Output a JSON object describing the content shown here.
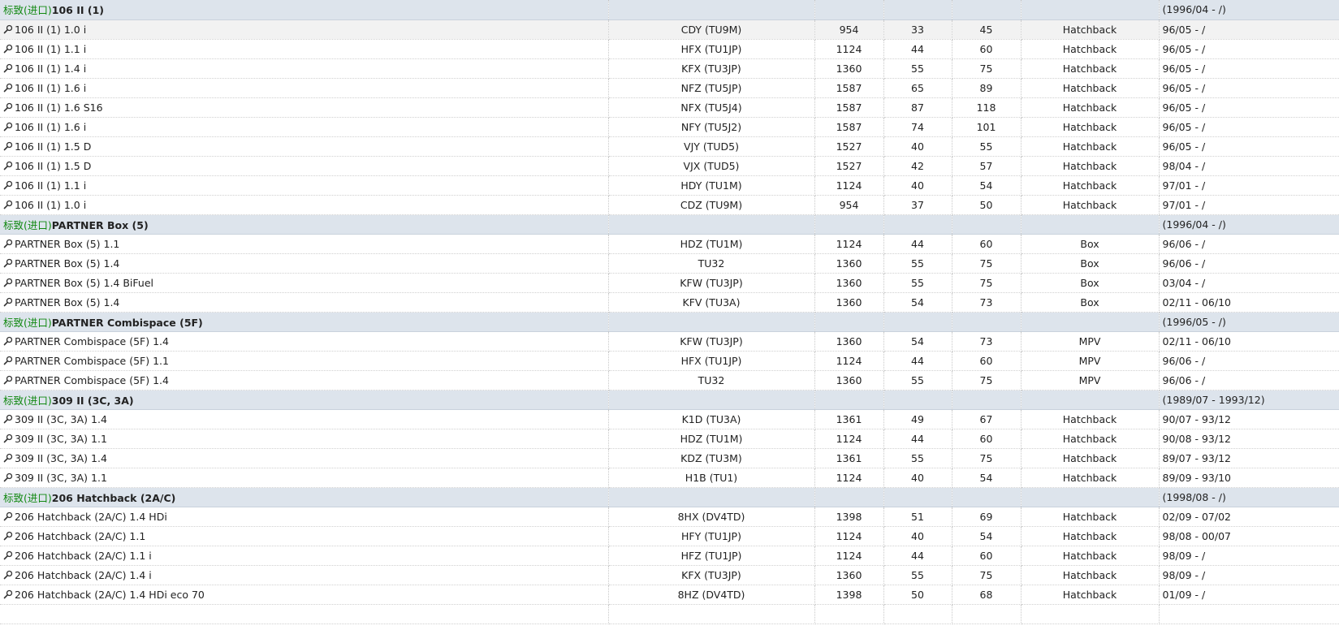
{
  "groups": [
    {
      "brand": "标致(进口)",
      "name": "106 II (1)",
      "years": "(1996/04 - /)",
      "rows": [
        {
          "model": "106 II (1) 1.0 i",
          "engine": "CDY (TU9M)",
          "ccm": "954",
          "kw": "33",
          "hp": "45",
          "body": "Hatchback",
          "years": "96/05 - /"
        },
        {
          "model": "106 II (1) 1.1 i",
          "engine": "HFX (TU1JP)",
          "ccm": "1124",
          "kw": "44",
          "hp": "60",
          "body": "Hatchback",
          "years": "96/05 - /"
        },
        {
          "model": "106 II (1) 1.4 i",
          "engine": "KFX (TU3JP)",
          "ccm": "1360",
          "kw": "55",
          "hp": "75",
          "body": "Hatchback",
          "years": "96/05 - /"
        },
        {
          "model": "106 II (1) 1.6 i",
          "engine": "NFZ (TU5JP)",
          "ccm": "1587",
          "kw": "65",
          "hp": "89",
          "body": "Hatchback",
          "years": "96/05 - /"
        },
        {
          "model": "106 II (1) 1.6 S16",
          "engine": "NFX (TU5J4)",
          "ccm": "1587",
          "kw": "87",
          "hp": "118",
          "body": "Hatchback",
          "years": "96/05 - /"
        },
        {
          "model": "106 II (1) 1.6 i",
          "engine": "NFY (TU5J2)",
          "ccm": "1587",
          "kw": "74",
          "hp": "101",
          "body": "Hatchback",
          "years": "96/05 - /"
        },
        {
          "model": "106 II (1) 1.5 D",
          "engine": "VJY (TUD5)",
          "ccm": "1527",
          "kw": "40",
          "hp": "55",
          "body": "Hatchback",
          "years": "96/05 - /"
        },
        {
          "model": "106 II (1) 1.5 D",
          "engine": "VJX (TUD5)",
          "ccm": "1527",
          "kw": "42",
          "hp": "57",
          "body": "Hatchback",
          "years": "98/04 - /"
        },
        {
          "model": "106 II (1) 1.1 i",
          "engine": "HDY (TU1M)",
          "ccm": "1124",
          "kw": "40",
          "hp": "54",
          "body": "Hatchback",
          "years": "97/01 - /"
        },
        {
          "model": "106 II (1) 1.0 i",
          "engine": "CDZ (TU9M)",
          "ccm": "954",
          "kw": "37",
          "hp": "50",
          "body": "Hatchback",
          "years": "97/01 - /"
        }
      ]
    },
    {
      "brand": "标致(进口)",
      "name": "PARTNER Box (5)",
      "years": "(1996/04 - /)",
      "rows": [
        {
          "model": "PARTNER Box (5) 1.1",
          "engine": "HDZ (TU1M)",
          "ccm": "1124",
          "kw": "44",
          "hp": "60",
          "body": "Box",
          "years": "96/06 - /"
        },
        {
          "model": "PARTNER Box (5) 1.4",
          "engine": "TU32",
          "ccm": "1360",
          "kw": "55",
          "hp": "75",
          "body": "Box",
          "years": "96/06 - /"
        },
        {
          "model": "PARTNER Box (5) 1.4 BiFuel",
          "engine": "KFW (TU3JP)",
          "ccm": "1360",
          "kw": "55",
          "hp": "75",
          "body": "Box",
          "years": "03/04 - /"
        },
        {
          "model": "PARTNER Box (5) 1.4",
          "engine": "KFV (TU3A)",
          "ccm": "1360",
          "kw": "54",
          "hp": "73",
          "body": "Box",
          "years": "02/11 - 06/10"
        }
      ]
    },
    {
      "brand": "标致(进口)",
      "name": "PARTNER Combispace (5F)",
      "years": "(1996/05 - /)",
      "rows": [
        {
          "model": "PARTNER Combispace (5F) 1.4",
          "engine": "KFW (TU3JP)",
          "ccm": "1360",
          "kw": "54",
          "hp": "73",
          "body": "MPV",
          "years": "02/11 - 06/10"
        },
        {
          "model": "PARTNER Combispace (5F) 1.1",
          "engine": "HFX (TU1JP)",
          "ccm": "1124",
          "kw": "44",
          "hp": "60",
          "body": "MPV",
          "years": "96/06 - /"
        },
        {
          "model": "PARTNER Combispace (5F) 1.4",
          "engine": "TU32",
          "ccm": "1360",
          "kw": "55",
          "hp": "75",
          "body": "MPV",
          "years": "96/06 - /"
        }
      ]
    },
    {
      "brand": "标致(进口)",
      "name": "309 II (3C, 3A)",
      "years": "(1989/07 - 1993/12)",
      "rows": [
        {
          "model": "309 II (3C, 3A) 1.4",
          "engine": "K1D (TU3A)",
          "ccm": "1361",
          "kw": "49",
          "hp": "67",
          "body": "Hatchback",
          "years": "90/07 - 93/12"
        },
        {
          "model": "309 II (3C, 3A) 1.1",
          "engine": "HDZ (TU1M)",
          "ccm": "1124",
          "kw": "44",
          "hp": "60",
          "body": "Hatchback",
          "years": "90/08 - 93/12"
        },
        {
          "model": "309 II (3C, 3A) 1.4",
          "engine": "KDZ (TU3M)",
          "ccm": "1361",
          "kw": "55",
          "hp": "75",
          "body": "Hatchback",
          "years": "89/07 - 93/12"
        },
        {
          "model": "309 II (3C, 3A) 1.1",
          "engine": "H1B (TU1)",
          "ccm": "1124",
          "kw": "40",
          "hp": "54",
          "body": "Hatchback",
          "years": "89/09 - 93/10"
        }
      ]
    },
    {
      "brand": "标致(进口)",
      "name": "206 Hatchback (2A/C)",
      "years": "(1998/08 - /)",
      "rows": [
        {
          "model": "206 Hatchback (2A/C) 1.4 HDi",
          "engine": "8HX (DV4TD)",
          "ccm": "1398",
          "kw": "51",
          "hp": "69",
          "body": "Hatchback",
          "years": "02/09 - 07/02"
        },
        {
          "model": "206 Hatchback (2A/C) 1.1",
          "engine": "HFY (TU1JP)",
          "ccm": "1124",
          "kw": "40",
          "hp": "54",
          "body": "Hatchback",
          "years": "98/08 - 00/07"
        },
        {
          "model": "206 Hatchback (2A/C) 1.1 i",
          "engine": "HFZ (TU1JP)",
          "ccm": "1124",
          "kw": "44",
          "hp": "60",
          "body": "Hatchback",
          "years": "98/09 - /"
        },
        {
          "model": "206 Hatchback (2A/C) 1.4 i",
          "engine": "KFX (TU3JP)",
          "ccm": "1360",
          "kw": "55",
          "hp": "75",
          "body": "Hatchback",
          "years": "98/09 - /"
        },
        {
          "model": "206 Hatchback (2A/C) 1.4 HDi eco 70",
          "engine": "8HZ (DV4TD)",
          "ccm": "1398",
          "kw": "50",
          "hp": "68",
          "body": "Hatchback",
          "years": "01/09 - /"
        },
        {
          "model": "",
          "engine": "",
          "ccm": "",
          "kw": "",
          "hp": "",
          "body": "",
          "years": ""
        }
      ]
    }
  ]
}
